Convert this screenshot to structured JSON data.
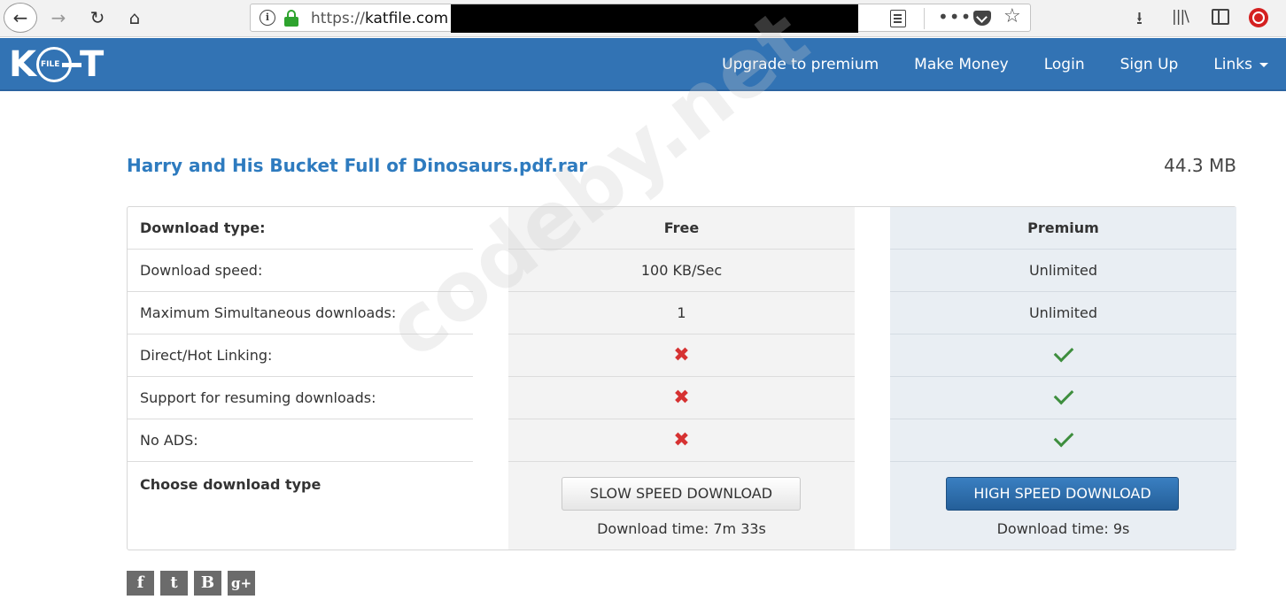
{
  "browser": {
    "url_scheme": "https://",
    "url_host": "katfile.com",
    "more_label": "•••"
  },
  "site": {
    "logo_left": "K",
    "logo_circle": "FILE",
    "logo_right": "T",
    "nav": [
      {
        "label": "Upgrade to premium"
      },
      {
        "label": "Make Money"
      },
      {
        "label": "Login"
      },
      {
        "label": "Sign Up"
      },
      {
        "label": "Links"
      }
    ]
  },
  "file": {
    "name": "Harry and His Bucket Full of Dinosaurs.pdf.rar",
    "size": "44.3 MB"
  },
  "table": {
    "header": {
      "label": "Download type:",
      "free": "Free",
      "premium": "Premium"
    },
    "rows": [
      {
        "label": "Download speed:",
        "free": "100 KB/Sec",
        "premium": "Unlimited"
      },
      {
        "label": "Maximum Simultaneous downloads:",
        "free": "1",
        "premium": "Unlimited"
      },
      {
        "label": "Direct/Hot Linking:",
        "free": "✖",
        "premium": "check"
      },
      {
        "label": "Support for resuming downloads:",
        "free": "✖",
        "premium": "check"
      },
      {
        "label": "No ADS:",
        "free": "✖",
        "premium": "check"
      }
    ],
    "choose_label": "Choose download type",
    "slow_button": "SLOW SPEED DOWNLOAD",
    "fast_button": "HIGH SPEED DOWNLOAD",
    "free_time": "Download time: 7m 33s",
    "premium_time": "Download time: 9s"
  },
  "watermark": "codeby.net",
  "social": [
    {
      "label": "f",
      "icon": "facebook-icon"
    },
    {
      "label": "t",
      "icon": "twitter-icon"
    },
    {
      "label": "B",
      "icon": "vk-icon"
    },
    {
      "label": "g+",
      "icon": "google-plus-icon"
    }
  ],
  "colors": {
    "nav_bg": "#3273b4",
    "title": "#2e7bbf",
    "cross": "#d63232",
    "check": "#3e8e3e",
    "primary_button": "#245f99"
  }
}
